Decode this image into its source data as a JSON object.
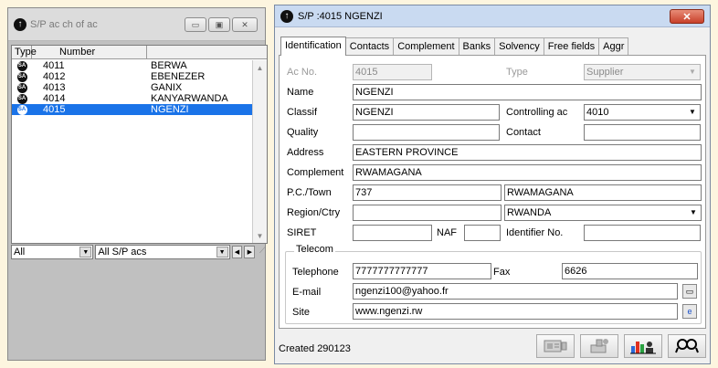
{
  "left_window": {
    "title": "S/P ac ch of ac",
    "columns": [
      "Type",
      "Number"
    ],
    "rows": [
      {
        "type_icon": "SA",
        "number": "4011",
        "name": "BERWA"
      },
      {
        "type_icon": "SA",
        "number": "4012",
        "name": "EBENEZER"
      },
      {
        "type_icon": "SA",
        "number": "4013",
        "name": "GANIX"
      },
      {
        "type_icon": "SA",
        "number": "4014",
        "name": "KANYARWANDA"
      },
      {
        "type_icon": "SA",
        "number": "4015",
        "name": "NGENZI"
      }
    ],
    "selected_index": 4,
    "filter1": "All",
    "filter2": "All S/P acs"
  },
  "right_window": {
    "title": "S/P :4015 NGENZI",
    "tabs": [
      "Identification",
      "Contacts",
      "Complement",
      "Banks",
      "Solvency",
      "Free fields",
      "Aggr"
    ],
    "active_tab": "Identification",
    "fields": {
      "ac_no_label": "Ac No.",
      "ac_no": "4015",
      "type_label": "Type",
      "type": "Supplier",
      "name_label": "Name",
      "name": "NGENZI",
      "classif_label": "Classif",
      "classif": "NGENZI",
      "controlling_label": "Controlling ac",
      "controlling": "4010",
      "quality_label": "Quality",
      "quality": "",
      "contact_label": "Contact",
      "contact": "",
      "address_label": "Address",
      "address": "EASTERN PROVINCE",
      "complement_label": "Complement",
      "complement": "RWAMAGANA",
      "pc_town_label": "P.C./Town",
      "pc": "737",
      "town": "RWAMAGANA",
      "region_label": "Region/Ctry",
      "region": "",
      "country": "RWANDA",
      "siret_label": "SIRET",
      "siret": "",
      "naf_label": "NAF",
      "naf": "",
      "identifier_label": "Identifier No.",
      "identifier": ""
    },
    "telecom": {
      "title": "Telecom",
      "telephone_label": "Telephone",
      "telephone": "7777777777777",
      "fax_label": "Fax",
      "fax": "6626",
      "email_label": "E-mail",
      "email": "ngenzi100@yahoo.fr",
      "site_label": "Site",
      "site": "www.ngenzi.rw"
    },
    "status": "Created 290123"
  },
  "icons": {
    "app": "circle-arrow-icon",
    "row_type": "sa-circle-icon",
    "toolbar": [
      "card-print-icon",
      "stamp-icon",
      "chart-user-icon",
      "search-people-icon"
    ]
  }
}
